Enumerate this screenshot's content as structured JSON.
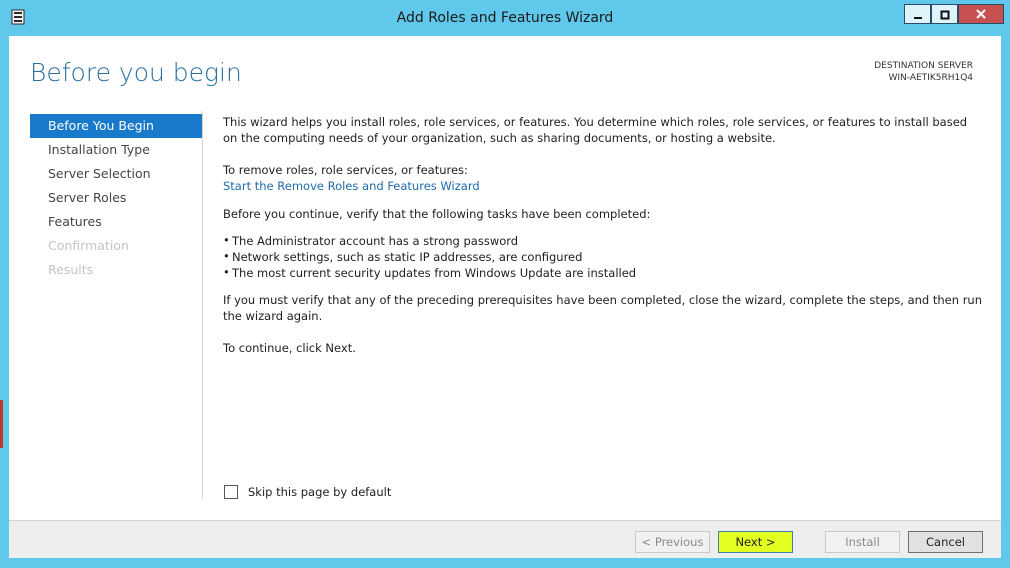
{
  "window": {
    "title": "Add Roles and Features Wizard",
    "controls": [
      "minimize",
      "maximize",
      "close"
    ]
  },
  "page": {
    "heading": "Before you begin",
    "destination_label": "DESTINATION SERVER",
    "destination_server": "WIN-AETIK5RH1Q4"
  },
  "nav": {
    "items": [
      {
        "label": "Before You Begin",
        "state": "active"
      },
      {
        "label": "Installation Type",
        "state": "enabled"
      },
      {
        "label": "Server Selection",
        "state": "enabled"
      },
      {
        "label": "Server Roles",
        "state": "enabled"
      },
      {
        "label": "Features",
        "state": "enabled"
      },
      {
        "label": "Confirmation",
        "state": "disabled"
      },
      {
        "label": "Results",
        "state": "disabled"
      }
    ]
  },
  "main": {
    "intro": "This wizard helps you install roles, role services, or features. You determine which roles, role services, or features to install based on the computing needs of your organization, such as sharing documents, or hosting a website.",
    "remove_label": "To remove roles, role services, or features:",
    "remove_link": "Start the Remove Roles and Features Wizard",
    "verify_intro": "Before you continue, verify that the following tasks have been completed:",
    "bullets": [
      "The Administrator account has a strong password",
      "Network settings, such as static IP addresses, are configured",
      "The most current security updates from Windows Update are installed"
    ],
    "prereq_note": "If you must verify that any of the preceding prerequisites have been completed, close the wizard, complete the steps, and then run the wizard again.",
    "continue_note": "To continue, click Next."
  },
  "skip": {
    "label": "Skip this page by default",
    "checked": false
  },
  "footer": {
    "previous_label": "< Previous",
    "next_label": "Next >",
    "install_label": "Install",
    "cancel_label": "Cancel"
  },
  "colors": {
    "frame": "#60c8ea",
    "accent": "#1979ca",
    "heading": "#2a6f9e",
    "next_highlight": "#e3ff22"
  }
}
